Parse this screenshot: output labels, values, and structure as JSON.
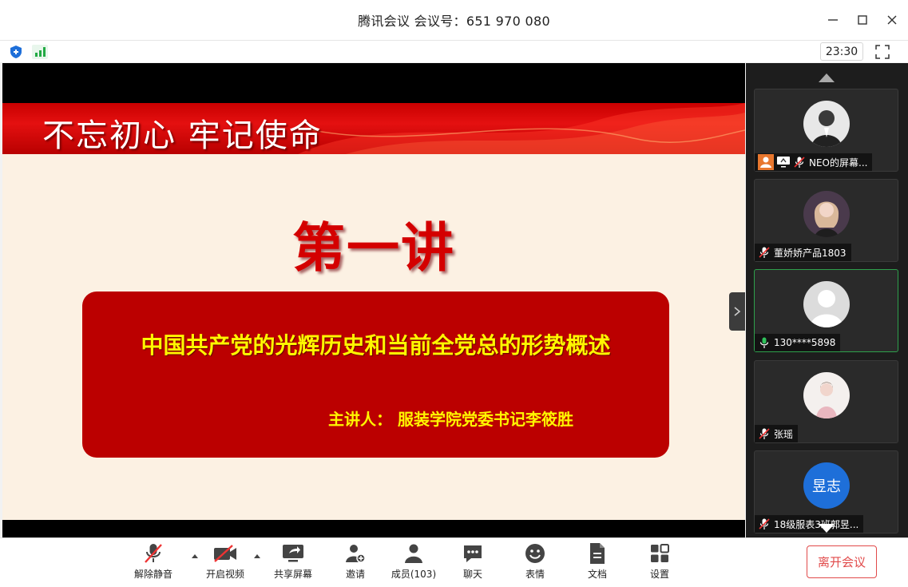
{
  "window": {
    "title": "腾讯会议 会议号：651 970 080",
    "clock": "23:30"
  },
  "slide": {
    "banner_text": "不忘初心 牢记使命",
    "lecture_title": "第一讲",
    "subject": "中国共产党的光辉历史和当前全党总的形势概述",
    "speaker": "主讲人：  服装学院党委书记李筱胜"
  },
  "participants": [
    {
      "name": "NEO的屏幕...",
      "status": "screen-sharing",
      "muted": true
    },
    {
      "name": "董娇娇产品1803",
      "muted": true
    },
    {
      "name": "130****5898",
      "muted": false,
      "speaking": true
    },
    {
      "name": "张瑶",
      "muted": true
    },
    {
      "name": "18级服表3班郭昱...",
      "avatar_text": "昱志",
      "muted": true
    }
  ],
  "toolbar": {
    "unmute": "解除静音",
    "video": "开启视频",
    "share": "共享屏幕",
    "invite": "邀请",
    "members": "成员(103)",
    "chat": "聊天",
    "reactions": "表情",
    "docs": "文档",
    "settings": "设置",
    "leave": "离开会议"
  },
  "colors": {
    "accent_red": "#e14a4a",
    "speaking_green": "#2ea04c",
    "slide_red": "#bb0000",
    "slide_yellow": "#fff600"
  }
}
